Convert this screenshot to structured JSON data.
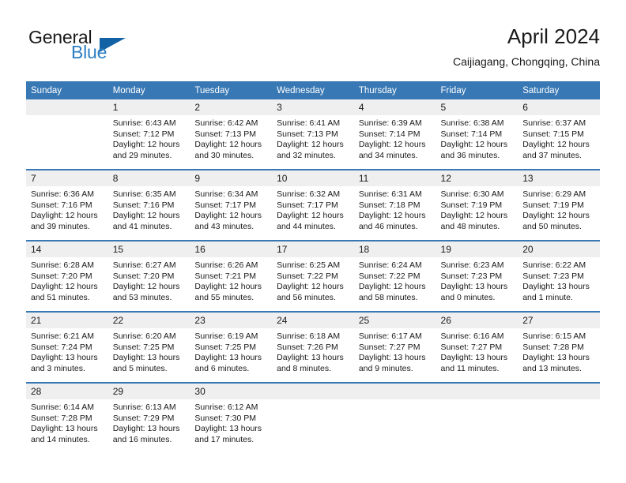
{
  "brand": {
    "name_part1": "General",
    "name_part2": "Blue",
    "triangle_color": "#1362a5",
    "blue_color": "#2c7fc4"
  },
  "header": {
    "title": "April 2024",
    "subtitle": "Caijiagang, Chongqing, China"
  },
  "theme": {
    "header_bg": "#3878b4",
    "daynum_bg": "#efefef",
    "separator": "#3878b4"
  },
  "weekdays": [
    "Sunday",
    "Monday",
    "Tuesday",
    "Wednesday",
    "Thursday",
    "Friday",
    "Saturday"
  ],
  "weeks": [
    [
      {
        "day": "",
        "lines": []
      },
      {
        "day": "1",
        "lines": [
          "Sunrise: 6:43 AM",
          "Sunset: 7:12 PM",
          "Daylight: 12 hours",
          "and 29 minutes."
        ]
      },
      {
        "day": "2",
        "lines": [
          "Sunrise: 6:42 AM",
          "Sunset: 7:13 PM",
          "Daylight: 12 hours",
          "and 30 minutes."
        ]
      },
      {
        "day": "3",
        "lines": [
          "Sunrise: 6:41 AM",
          "Sunset: 7:13 PM",
          "Daylight: 12 hours",
          "and 32 minutes."
        ]
      },
      {
        "day": "4",
        "lines": [
          "Sunrise: 6:39 AM",
          "Sunset: 7:14 PM",
          "Daylight: 12 hours",
          "and 34 minutes."
        ]
      },
      {
        "day": "5",
        "lines": [
          "Sunrise: 6:38 AM",
          "Sunset: 7:14 PM",
          "Daylight: 12 hours",
          "and 36 minutes."
        ]
      },
      {
        "day": "6",
        "lines": [
          "Sunrise: 6:37 AM",
          "Sunset: 7:15 PM",
          "Daylight: 12 hours",
          "and 37 minutes."
        ]
      }
    ],
    [
      {
        "day": "7",
        "lines": [
          "Sunrise: 6:36 AM",
          "Sunset: 7:16 PM",
          "Daylight: 12 hours",
          "and 39 minutes."
        ]
      },
      {
        "day": "8",
        "lines": [
          "Sunrise: 6:35 AM",
          "Sunset: 7:16 PM",
          "Daylight: 12 hours",
          "and 41 minutes."
        ]
      },
      {
        "day": "9",
        "lines": [
          "Sunrise: 6:34 AM",
          "Sunset: 7:17 PM",
          "Daylight: 12 hours",
          "and 43 minutes."
        ]
      },
      {
        "day": "10",
        "lines": [
          "Sunrise: 6:32 AM",
          "Sunset: 7:17 PM",
          "Daylight: 12 hours",
          "and 44 minutes."
        ]
      },
      {
        "day": "11",
        "lines": [
          "Sunrise: 6:31 AM",
          "Sunset: 7:18 PM",
          "Daylight: 12 hours",
          "and 46 minutes."
        ]
      },
      {
        "day": "12",
        "lines": [
          "Sunrise: 6:30 AM",
          "Sunset: 7:19 PM",
          "Daylight: 12 hours",
          "and 48 minutes."
        ]
      },
      {
        "day": "13",
        "lines": [
          "Sunrise: 6:29 AM",
          "Sunset: 7:19 PM",
          "Daylight: 12 hours",
          "and 50 minutes."
        ]
      }
    ],
    [
      {
        "day": "14",
        "lines": [
          "Sunrise: 6:28 AM",
          "Sunset: 7:20 PM",
          "Daylight: 12 hours",
          "and 51 minutes."
        ]
      },
      {
        "day": "15",
        "lines": [
          "Sunrise: 6:27 AM",
          "Sunset: 7:20 PM",
          "Daylight: 12 hours",
          "and 53 minutes."
        ]
      },
      {
        "day": "16",
        "lines": [
          "Sunrise: 6:26 AM",
          "Sunset: 7:21 PM",
          "Daylight: 12 hours",
          "and 55 minutes."
        ]
      },
      {
        "day": "17",
        "lines": [
          "Sunrise: 6:25 AM",
          "Sunset: 7:22 PM",
          "Daylight: 12 hours",
          "and 56 minutes."
        ]
      },
      {
        "day": "18",
        "lines": [
          "Sunrise: 6:24 AM",
          "Sunset: 7:22 PM",
          "Daylight: 12 hours",
          "and 58 minutes."
        ]
      },
      {
        "day": "19",
        "lines": [
          "Sunrise: 6:23 AM",
          "Sunset: 7:23 PM",
          "Daylight: 13 hours",
          "and 0 minutes."
        ]
      },
      {
        "day": "20",
        "lines": [
          "Sunrise: 6:22 AM",
          "Sunset: 7:23 PM",
          "Daylight: 13 hours",
          "and 1 minute."
        ]
      }
    ],
    [
      {
        "day": "21",
        "lines": [
          "Sunrise: 6:21 AM",
          "Sunset: 7:24 PM",
          "Daylight: 13 hours",
          "and 3 minutes."
        ]
      },
      {
        "day": "22",
        "lines": [
          "Sunrise: 6:20 AM",
          "Sunset: 7:25 PM",
          "Daylight: 13 hours",
          "and 5 minutes."
        ]
      },
      {
        "day": "23",
        "lines": [
          "Sunrise: 6:19 AM",
          "Sunset: 7:25 PM",
          "Daylight: 13 hours",
          "and 6 minutes."
        ]
      },
      {
        "day": "24",
        "lines": [
          "Sunrise: 6:18 AM",
          "Sunset: 7:26 PM",
          "Daylight: 13 hours",
          "and 8 minutes."
        ]
      },
      {
        "day": "25",
        "lines": [
          "Sunrise: 6:17 AM",
          "Sunset: 7:27 PM",
          "Daylight: 13 hours",
          "and 9 minutes."
        ]
      },
      {
        "day": "26",
        "lines": [
          "Sunrise: 6:16 AM",
          "Sunset: 7:27 PM",
          "Daylight: 13 hours",
          "and 11 minutes."
        ]
      },
      {
        "day": "27",
        "lines": [
          "Sunrise: 6:15 AM",
          "Sunset: 7:28 PM",
          "Daylight: 13 hours",
          "and 13 minutes."
        ]
      }
    ],
    [
      {
        "day": "28",
        "lines": [
          "Sunrise: 6:14 AM",
          "Sunset: 7:28 PM",
          "Daylight: 13 hours",
          "and 14 minutes."
        ]
      },
      {
        "day": "29",
        "lines": [
          "Sunrise: 6:13 AM",
          "Sunset: 7:29 PM",
          "Daylight: 13 hours",
          "and 16 minutes."
        ]
      },
      {
        "day": "30",
        "lines": [
          "Sunrise: 6:12 AM",
          "Sunset: 7:30 PM",
          "Daylight: 13 hours",
          "and 17 minutes."
        ]
      },
      {
        "day": "",
        "lines": []
      },
      {
        "day": "",
        "lines": []
      },
      {
        "day": "",
        "lines": []
      },
      {
        "day": "",
        "lines": []
      }
    ]
  ]
}
